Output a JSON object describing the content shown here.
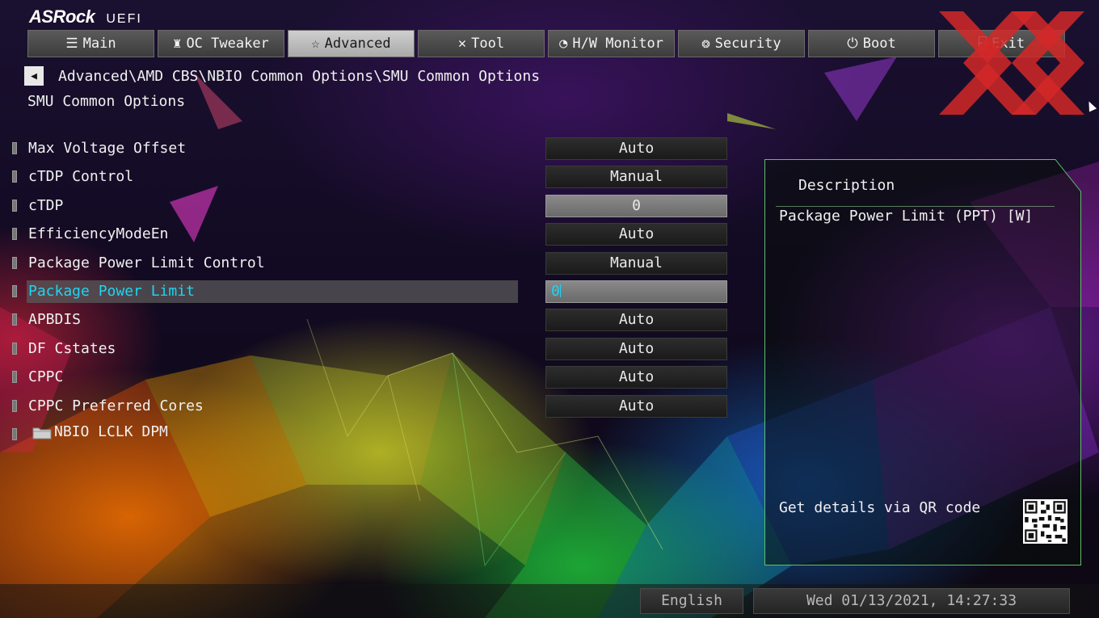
{
  "brand": {
    "name": "ASRock",
    "product": "UEFI"
  },
  "tabs": [
    {
      "label": "Main",
      "icon": "list-icon",
      "glyph": "☰"
    },
    {
      "label": "OC Tweaker",
      "icon": "rocket-icon",
      "glyph": "♜"
    },
    {
      "label": "Advanced",
      "icon": "star-icon",
      "glyph": "☆"
    },
    {
      "label": "Tool",
      "icon": "tools-icon",
      "glyph": "✕"
    },
    {
      "label": "H/W Monitor",
      "icon": "gauge-icon",
      "glyph": "◔"
    },
    {
      "label": "Security",
      "icon": "shield-icon",
      "glyph": "❂"
    },
    {
      "label": "Boot",
      "icon": "power-icon",
      "glyph": "⏻"
    },
    {
      "label": "Exit",
      "icon": "exit-icon",
      "glyph": "⍈"
    }
  ],
  "active_tab": "Advanced",
  "breadcrumb": "Advanced\\AMD CBS\\NBIO Common Options\\SMU Common Options",
  "page_title": "SMU Common Options",
  "settings": [
    {
      "label": "Max Voltage Offset",
      "value": "Auto"
    },
    {
      "label": "cTDP Control",
      "value": "Manual"
    },
    {
      "label": "cTDP",
      "value": "0"
    },
    {
      "label": "EfficiencyModeEn",
      "value": "Auto"
    },
    {
      "label": "Package Power Limit Control",
      "value": "Manual"
    },
    {
      "label": "Package Power Limit",
      "value": "0"
    },
    {
      "label": "APBDIS",
      "value": "Auto"
    },
    {
      "label": "DF Cstates",
      "value": "Auto"
    },
    {
      "label": "CPPC",
      "value": "Auto"
    },
    {
      "label": "CPPC Preferred Cores",
      "value": "Auto"
    }
  ],
  "submenu": {
    "label": "NBIO LCLK DPM",
    "icon": "folder-icon"
  },
  "description": {
    "title": "Description",
    "text": "Package Power Limit (PPT) [W]",
    "qr_hint": "Get details via QR code"
  },
  "footer": {
    "language": "English",
    "datetime": "Wed 01/13/2021, 14:27:33"
  },
  "colors": {
    "highlight_text": "#22d3f0",
    "active_tab": "#bfbfbf",
    "panel_border": "#5fbf6a",
    "watermark": "#d42828"
  }
}
